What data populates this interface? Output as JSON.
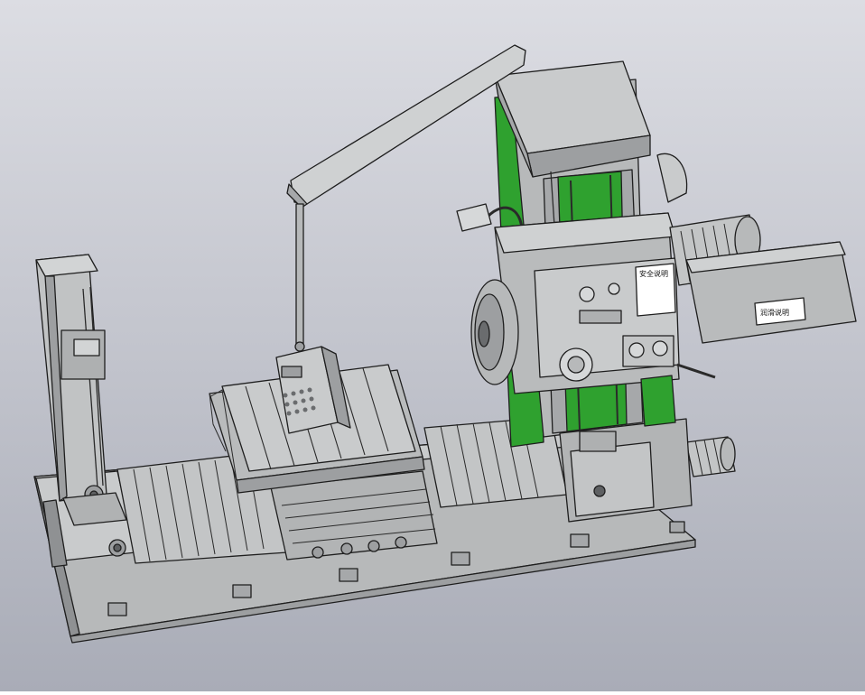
{
  "scene": {
    "background_top": "#dcdde3",
    "background_bottom": "#a9acb7",
    "metal_light": "#c9cbcc",
    "metal_mid": "#b7b9ba",
    "metal_dark": "#8f9193",
    "outline": "#1e1e1e",
    "accent_green": "#2fa12f",
    "labels": {
      "safety_plate": "安全说明",
      "spindle_plate": "润滑说明"
    }
  }
}
